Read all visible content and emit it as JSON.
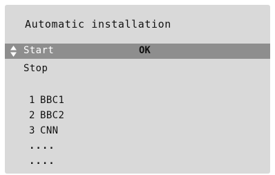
{
  "screen": {
    "title": "Automatic installation"
  },
  "menu": {
    "start_label": "Start",
    "stop_label": "Stop",
    "status": "OK",
    "selected": "start"
  },
  "channels": [
    {
      "number": "1",
      "name": "BBC1"
    },
    {
      "number": "2",
      "name": "BBC2"
    },
    {
      "number": "3",
      "name": "CNN"
    }
  ],
  "placeholders": [
    "....",
    "...."
  ],
  "colors": {
    "background": "#d9d9d9",
    "highlight": "#8e8e8e",
    "text": "#111111",
    "highlight_text": "#ffffff"
  },
  "icons": {
    "selector": "up-down-arrows-icon"
  }
}
